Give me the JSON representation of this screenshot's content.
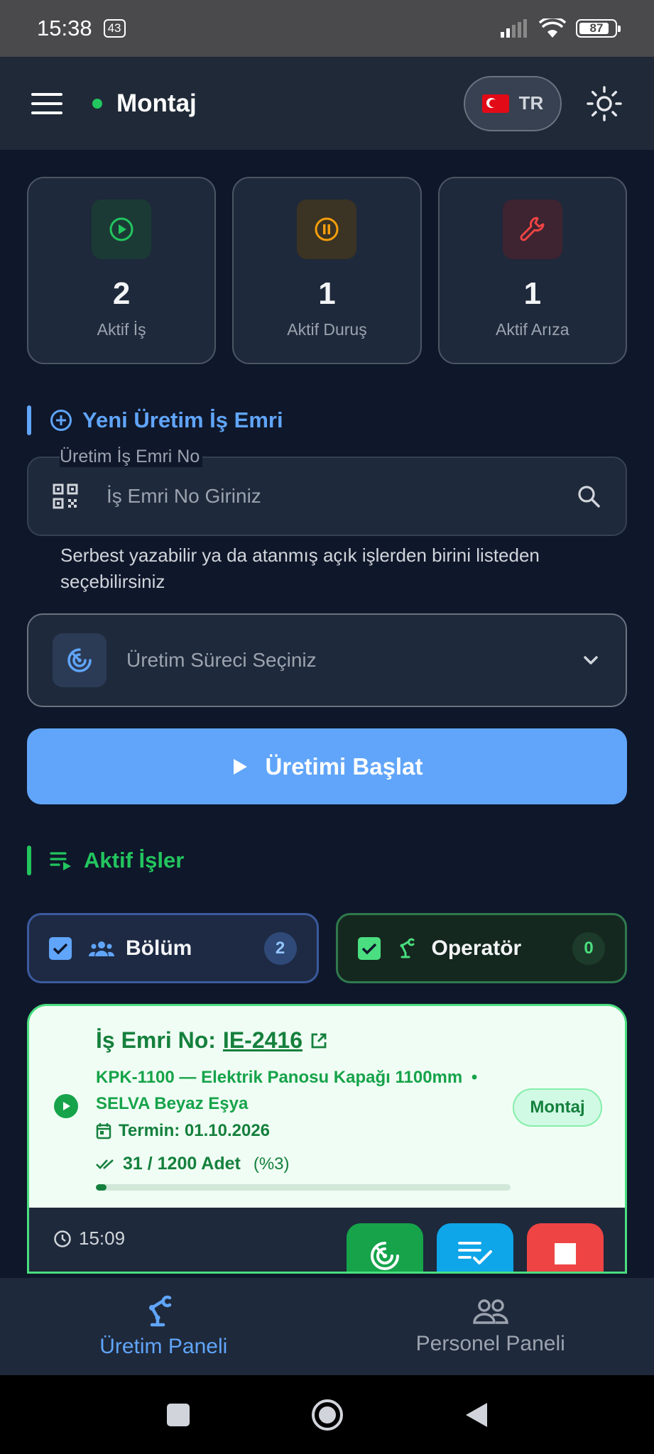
{
  "status_bar": {
    "time": "15:38",
    "notification_count": "43",
    "battery": "87"
  },
  "header": {
    "title": "Montaj",
    "language": "TR"
  },
  "stats": [
    {
      "value": "2",
      "label": "Aktif İş"
    },
    {
      "value": "1",
      "label": "Aktif Duruş"
    },
    {
      "value": "1",
      "label": "Aktif Arıza"
    }
  ],
  "new_order": {
    "section_title": "Yeni Üretim İş Emri",
    "field_label": "Üretim İş Emri No",
    "field_placeholder": "İş Emri No Giriniz",
    "field_value": "",
    "helper": "Serbest yazabilir ya da atanmış açık işlerden birini listeden seçebilirsiniz",
    "process_placeholder": "Üretim Süreci Seçiniz",
    "start_label": "Üretimi Başlat"
  },
  "active_jobs": {
    "section_title": "Aktif İşler",
    "filters": [
      {
        "label": "Bölüm",
        "count": "2",
        "checked": true
      },
      {
        "label": "Operatör",
        "count": "0",
        "checked": true
      }
    ],
    "jobs": [
      {
        "title_prefix": "İş Emri No:",
        "order_no": "IE-2416",
        "product": "KPK-1100 — Elektrik Panosu Kapağı 1100mm",
        "separator": "•",
        "customer": "SELVA Beyaz Eşya",
        "deadline": "Termin: 01.10.2026",
        "quantity": "31 / 1200 Adet",
        "percent": "(%3)",
        "progress_fraction": 0.026,
        "station": "Montaj",
        "started_at": "15:09"
      }
    ]
  },
  "bottom_nav": [
    {
      "label": "Üretim Paneli",
      "active": true
    },
    {
      "label": "Personel Paneli",
      "active": false
    }
  ],
  "colors": {
    "background": "#0f172a",
    "primary": "#60a5fa",
    "success": "#22c55e",
    "warning": "#f59e0b",
    "danger": "#ef4444"
  }
}
